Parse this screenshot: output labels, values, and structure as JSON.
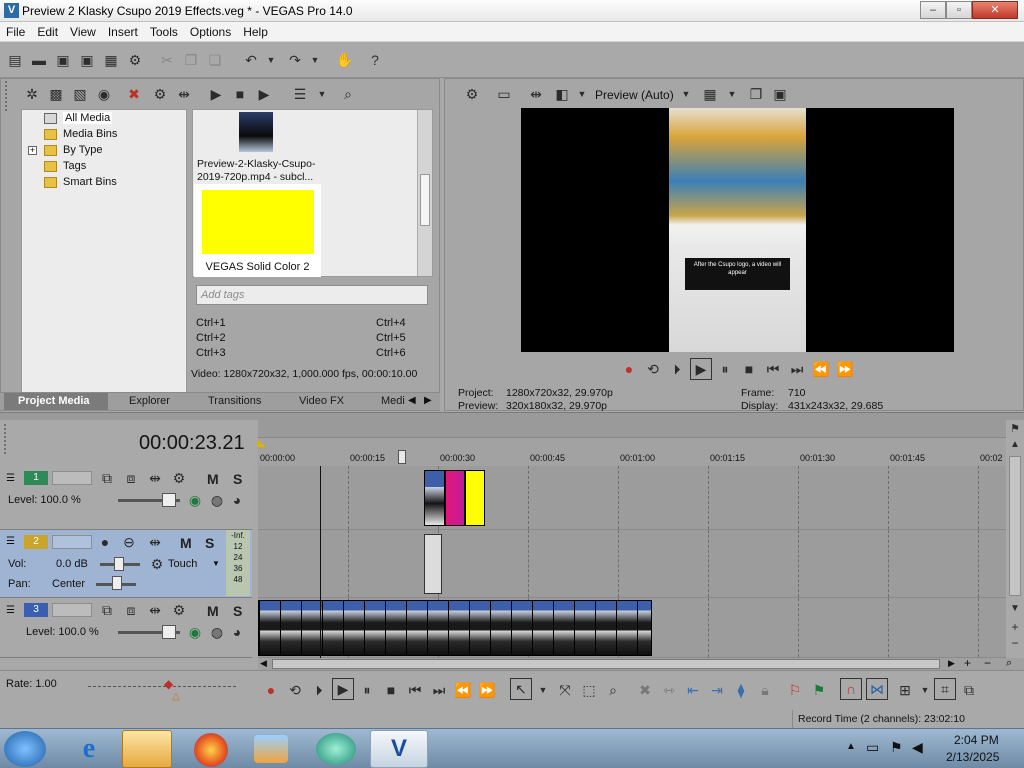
{
  "window": {
    "title": "Preview 2 Klasky Csupo 2019 Effects.veg * - VEGAS Pro 14.0",
    "logo_letter": "V",
    "minimize": "–",
    "maximize": "▫",
    "close": "✕"
  },
  "menu": [
    "File",
    "Edit",
    "View",
    "Insert",
    "Tools",
    "Options",
    "Help"
  ],
  "explorer": {
    "tree": [
      "All Media",
      "Media Bins",
      "By Type",
      "Tags",
      "Smart Bins"
    ],
    "expand_glyph": "+",
    "media": [
      {
        "name": "Preview-2-Klasky-Csupo-2019-720p.mp4 - subcl..."
      },
      {
        "name": "VEGAS Solid Color 2",
        "color": "#ffff00"
      }
    ],
    "tags_placeholder": "Add tags",
    "shortcuts": [
      "Ctrl+1",
      "Ctrl+4",
      "Ctrl+2",
      "Ctrl+5",
      "Ctrl+3",
      "Ctrl+6"
    ],
    "video_info": "Video: 1280x720x32, 1,000.000 fps, 00:00:10.00",
    "tabs": [
      "Project Media",
      "Explorer",
      "Transitions",
      "Video FX",
      "Medi"
    ]
  },
  "preview": {
    "mode": "Preview (Auto)",
    "project": "Project:",
    "project_val": "1280x720x32, 29.970p",
    "preview": "Preview:",
    "preview_val": "320x180x32, 29.970p",
    "frame": "Frame:",
    "frame_val": "710",
    "display": "Display:",
    "display_val": "431x243x32, 29.685",
    "overlay_text": "After the Csupo logo, a video will appear"
  },
  "timeline": {
    "timecode": "00:00:23.21",
    "ruler": [
      "00:00:00",
      "00:00:15",
      "00:00:30",
      "00:00:45",
      "00:01:00",
      "00:01:15",
      "00:01:30",
      "00:01:45",
      "00:02"
    ],
    "tracks": [
      {
        "num": "1",
        "level": "Level: 100.0 %"
      },
      {
        "num": "2",
        "vol_label": "Vol:",
        "vol": "0.0 dB",
        "pan_label": "Pan:",
        "pan": "Center",
        "touch": "Touch",
        "meter": [
          "-Inf.",
          "12",
          "24",
          "36",
          "48"
        ]
      },
      {
        "num": "3",
        "level": "Level: 100.0 %"
      }
    ],
    "m_label": "M",
    "s_label": "S",
    "rate": "Rate: 1.00"
  },
  "status": {
    "record_time": "Record Time (2 channels): 23:02:10"
  },
  "taskbar": {
    "time": "2:04 PM",
    "date": "2/13/2025"
  },
  "colors": {
    "track1": "#2e8b57",
    "track2": "#c9a52b",
    "track3": "#3a5fb0",
    "clip_magenta": "#e0187a",
    "clip_yellow": "#ffff00"
  }
}
